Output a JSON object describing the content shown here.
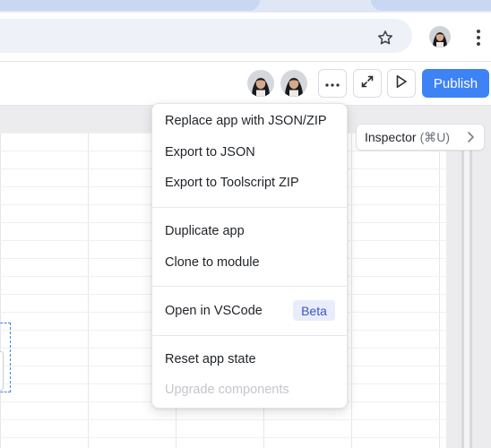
{
  "browser": {
    "star_icon": "star-icon",
    "profile_avatar_icon": "avatar-icon",
    "menu_icon": "kebab-menu-icon"
  },
  "header": {
    "collaborators": [
      "collaborator-avatar",
      "collaborator-avatar"
    ],
    "more_icon": "ellipsis-icon",
    "expand_icon": "expand-icon",
    "preview_icon": "play-icon",
    "publish_label": "Publish",
    "publish_color": "#3d83f5"
  },
  "inspector": {
    "label": "Inspector",
    "shortcut": "(⌘U)",
    "chevron_icon": "chevron-right-icon"
  },
  "menu": {
    "items": [
      {
        "label": "Replace app with JSON/ZIP",
        "enabled": true
      },
      {
        "label": "Export to JSON",
        "enabled": true
      },
      {
        "label": "Export to Toolscript ZIP",
        "enabled": true
      },
      {
        "label": "Duplicate app",
        "enabled": true
      },
      {
        "label": "Clone to module",
        "enabled": true
      },
      {
        "label": "Open in VSCode",
        "enabled": true,
        "badge": "Beta"
      },
      {
        "label": "Reset app state",
        "enabled": true
      },
      {
        "label": "Upgrade components",
        "enabled": false
      }
    ],
    "badge_color": "#3b55c9"
  }
}
